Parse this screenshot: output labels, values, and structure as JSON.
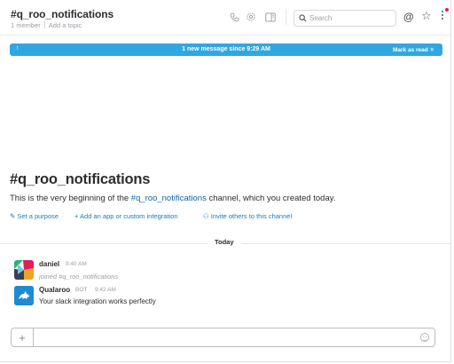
{
  "channel": {
    "name": "#q_roo_notifications",
    "member_count": "1 member",
    "add_topic": "Add a topic"
  },
  "search": {
    "placeholder": "Search"
  },
  "header_icons": [
    "phone-icon",
    "gear-icon",
    "sidebar-panel-icon",
    "at-mention-icon",
    "star-icon",
    "more-vertical-icon"
  ],
  "new_messages_bar": {
    "arrow": "↑",
    "text": "1 new message since 9:29 AM",
    "mark_as_read": "Mark as read ✕"
  },
  "intro": {
    "title": "#q_roo_notifications",
    "text_before": "This is the very beginning of the ",
    "channel_link": "#q_roo_notifications",
    "text_after": " channel, which you created today.",
    "actions": {
      "set_purpose": "✎ Set a purpose",
      "add_app": "+  Add an app or custom integration",
      "invite": "⚇ Invite others to this channel"
    }
  },
  "day_divider": "Today",
  "messages": [
    {
      "author": "daniel",
      "time": "9:40 AM",
      "text": "joined #q_roo_notifications",
      "bot": ""
    },
    {
      "author": "Qualaroo",
      "bot": "BOT",
      "time": "9:42 AM",
      "text": "Your slack integration works perfectly"
    }
  ],
  "composer": {
    "plus": "+",
    "placeholder": ""
  },
  "colors": {
    "banner_blue": "#2fa8e0",
    "link_blue": "#1264a3",
    "qualaroo_teal": "#1e8bd1"
  }
}
